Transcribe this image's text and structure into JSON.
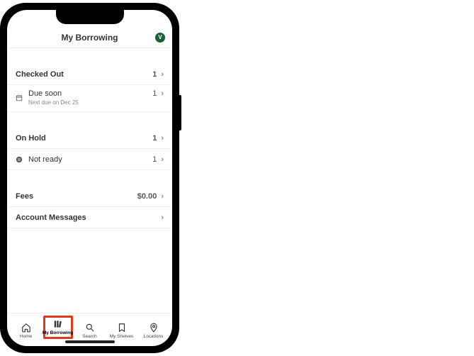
{
  "header": {
    "title": "My Borrowing",
    "avatar_initial": "V"
  },
  "sections": {
    "checked_out": {
      "label": "Checked Out",
      "value": "1"
    },
    "due_soon": {
      "label": "Due soon",
      "sublabel": "Next due on Dec 25",
      "value": "1"
    },
    "on_hold": {
      "label": "On Hold",
      "value": "1"
    },
    "not_ready": {
      "label": "Not ready",
      "value": "1"
    },
    "fees": {
      "label": "Fees",
      "value": "$0.00"
    },
    "messages": {
      "label": "Account Messages"
    }
  },
  "tabs": {
    "home": "Home",
    "borrowing": "My Borrowing",
    "search": "Search",
    "shelves": "My Shelves",
    "locations": "Locations"
  }
}
